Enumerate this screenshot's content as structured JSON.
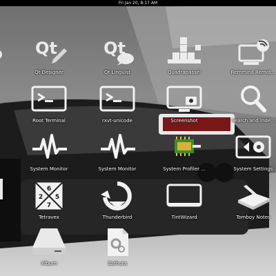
{
  "topbar": {
    "datetime": "Fri Jan 20, 8:17 AM"
  },
  "apps": [
    {
      "label": "Qt Designer",
      "icon": "qt-designer-icon"
    },
    {
      "label": "Qt Linguist",
      "icon": "qt-linguist-icon"
    },
    {
      "label": "Quadrapassel",
      "icon": "quadrapassel-icon"
    },
    {
      "label": "Remmina Remot...",
      "icon": "remote-desktop-icon"
    },
    {
      "label": "Root Terminal",
      "icon": "terminal-icon"
    },
    {
      "label": "rxvt-unicode",
      "icon": "terminal-icon"
    },
    {
      "label": "Screenshot",
      "icon": "screenshot-icon"
    },
    {
      "label": "Search and Inde...",
      "icon": "search-icon"
    },
    {
      "label": "System Monitor",
      "icon": "system-monitor-icon"
    },
    {
      "label": "System Monitor",
      "icon": "system-monitor-icon"
    },
    {
      "label": "System Profiler ...",
      "icon": "system-profiler-icon"
    },
    {
      "label": "System Settings",
      "icon": "system-settings-icon"
    },
    {
      "label": "Tetravex",
      "icon": "tetravex-icon"
    },
    {
      "label": "Thunderbird",
      "icon": "thunderbird-icon"
    },
    {
      "label": "TintWizard",
      "icon": "tintwizard-icon"
    },
    {
      "label": "Tomboy Notes",
      "icon": "tomboy-notes-icon"
    },
    {
      "label": "Xfburn",
      "icon": "xfburn-icon"
    },
    {
      "label": "Zathura",
      "icon": "zathura-icon"
    }
  ],
  "tetravex_digits": [
    "6",
    "2",
    "5",
    "7"
  ],
  "colors": {
    "topbar": "#000000",
    "label": "#ffffff",
    "profiler_chip": "#3a8f2c"
  }
}
